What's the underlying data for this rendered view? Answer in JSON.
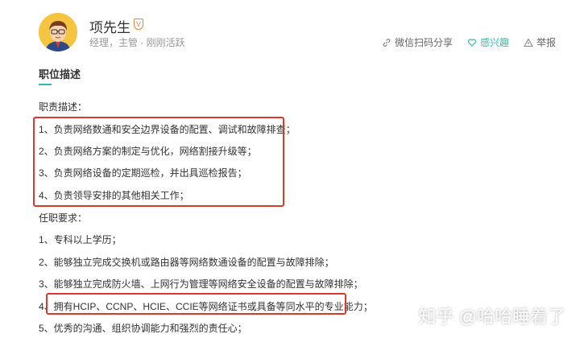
{
  "profile": {
    "name": "项先生",
    "verified_mark": "V",
    "meta": "经理，主管 · 刚刚活跃"
  },
  "actions": {
    "share": "微信扫码分享",
    "interest": "感兴趣",
    "report": "举报"
  },
  "section": {
    "title": "职位描述"
  },
  "content": {
    "duties_heading": "职责描述：",
    "duties": [
      "1、负责网络数通和安全边界设备的配置、调试和故障排查；",
      "2、负责网络方案的制定与优化，网络割接升级等；",
      "3、负责网络设备的定期巡检，并出具巡检报告；",
      "4、负责领导安排的其他相关工作；"
    ],
    "requirements_heading": "任职要求：",
    "requirements": [
      "1、专科以上学历；",
      "2、能够独立完成交换机或路由器等网络数通设备的配置与故障排除；",
      "3、能够独立完成防火墙、上网行为管理等网络安全设备的配置与故障排除；",
      "4、拥有HCIP、CCNP、HCIE、CCIE等网络证书或具备等同水平的专业能力；",
      "5、优秀的沟通、组织协调能力和强烈的责任心；"
    ]
  },
  "watermark": "知乎 @哈哈睡着了",
  "colors": {
    "accent": "#2fbfa8",
    "highlight_border": "#d93a2b",
    "verified": "#e8833a"
  }
}
